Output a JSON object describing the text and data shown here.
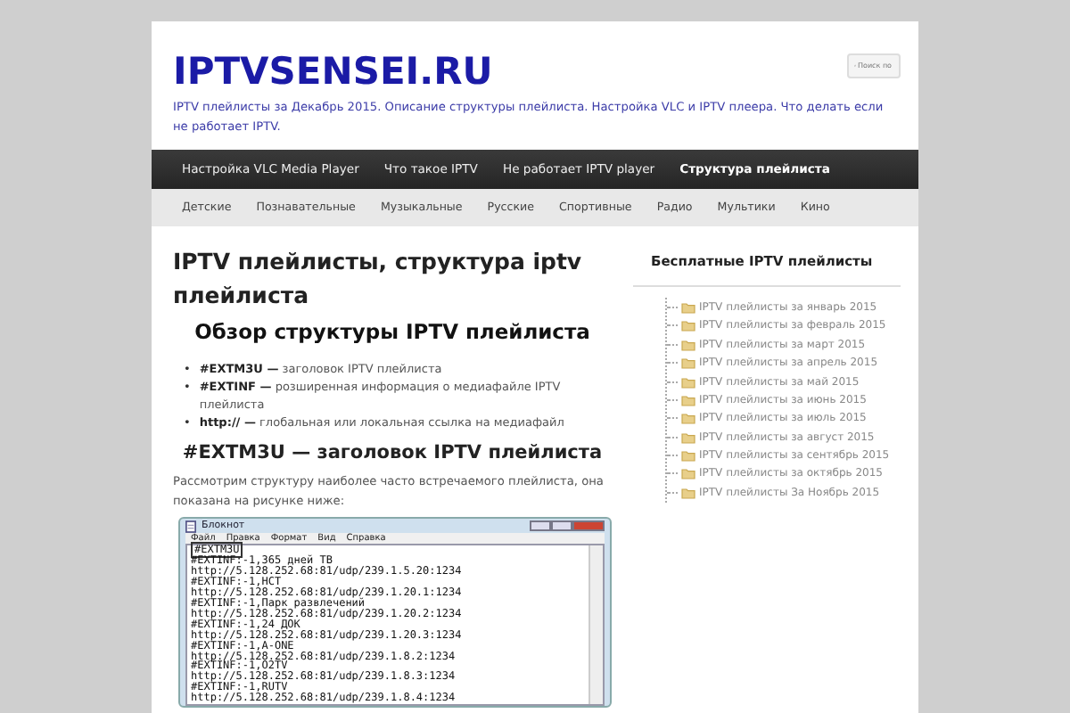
{
  "site": {
    "title": "IPTVSENSEI.RU",
    "tagline": "IPTV плейлисты за Декабрь 2015. Описание структуры плейлиста. Настройка VLC и IPTV плеера. Что делать если не работает IPTV.",
    "search_placeholder": "Поиск по"
  },
  "main_menu": [
    {
      "label": "Настройка VLC Media Player",
      "selected": false
    },
    {
      "label": "Что такое IPTV",
      "selected": false
    },
    {
      "label": "Не работает IPTV player",
      "selected": false
    },
    {
      "label": "Структура плейлиста",
      "selected": true
    }
  ],
  "sub_menu": [
    "Детские",
    "Познавательные",
    "Музыкальные",
    "Русские",
    "Спортивные",
    "Радио",
    "Мультики",
    "Кино"
  ],
  "article": {
    "title": "IPTV плейлисты, структура iptv плейлиста",
    "section_title": "Обзор структуры IPTV плейлиста",
    "bullets": [
      {
        "marker": "•",
        "text": "**#EXTM3U —** заголовок IPTV плейлиста"
      },
      {
        "marker": "•",
        "text": "**#EXTINF   —** розширенная информация о медиафайле IPTV плейлиста"
      },
      {
        "marker": "•",
        "text": "**http:// —** глобальная или локальная ссылка на медиафайл"
      }
    ],
    "subheading": "#EXTM3U  — заголовок IPTV плейлиста",
    "paragraph": "Рассмотрим структуру наиболее часто встречаемого плейлиста, она показана на рисунке ниже:",
    "figure": {
      "title": "Блокнот",
      "menu": [
        "Файл",
        "Правка",
        "Формат",
        "Вид",
        "Справка"
      ],
      "lines": [
        {
          "text": "#EXTM3U",
          "highlighted": true
        },
        {
          "text": "#EXTINF:-1,365 дней ТВ",
          "highlighted": false
        },
        {
          "text": "http://5.128.252.68:81/udp/239.1.5.20:1234",
          "highlighted": false
        },
        {
          "text": "#EXTINF:-1,НСТ",
          "highlighted": false
        },
        {
          "text": "http://5.128.252.68:81/udp/239.1.20.1:1234",
          "highlighted": false
        },
        {
          "text": "#EXTINF:-1,Парк развлечений",
          "highlighted": false
        },
        {
          "text": "http://5.128.252.68:81/udp/239.1.20.2:1234",
          "highlighted": false
        },
        {
          "text": "#EXTINF:-1,24 ДОК",
          "highlighted": false
        },
        {
          "text": "http://5.128.252.68:81/udp/239.1.20.3:1234",
          "highlighted": false
        },
        {
          "text": "#EXTINF:-1,A-ONE",
          "highlighted": false
        },
        {
          "text": "http://5.128.252.68:81/udp/239.1.8.2:1234",
          "highlighted": false
        },
        {
          "text": "#EXTINF:-1,O2TV",
          "highlighted": false
        },
        {
          "text": "http://5.128.252.68:81/udp/239.1.8.3:1234",
          "highlighted": false
        },
        {
          "text": "#EXTINF:-1,RUTV",
          "highlighted": false
        },
        {
          "text": "http://5.128.252.68:81/udp/239.1.8.4:1234",
          "highlighted": false
        }
      ]
    }
  },
  "sidebar": {
    "title": "Бесплатные IPTV плейлисты",
    "links": [
      "IPTV плейлисты за январь 2015",
      "IPTV плейлисты за февраль 2015",
      "IPTV плейлисты за март 2015",
      "IPTV плейлисты за апрель 2015",
      "IPTV плейлисты за май 2015",
      "IPTV плейлисты за июнь 2015",
      "IPTV плейлисты за июль 2015",
      "IPTV плейлисты за август 2015",
      "IPTV плейлисты за сентябрь 2015",
      "IPTV плейлисты за октябрь 2015",
      "IPTV плейлисты За Ноябрь 2015"
    ]
  }
}
